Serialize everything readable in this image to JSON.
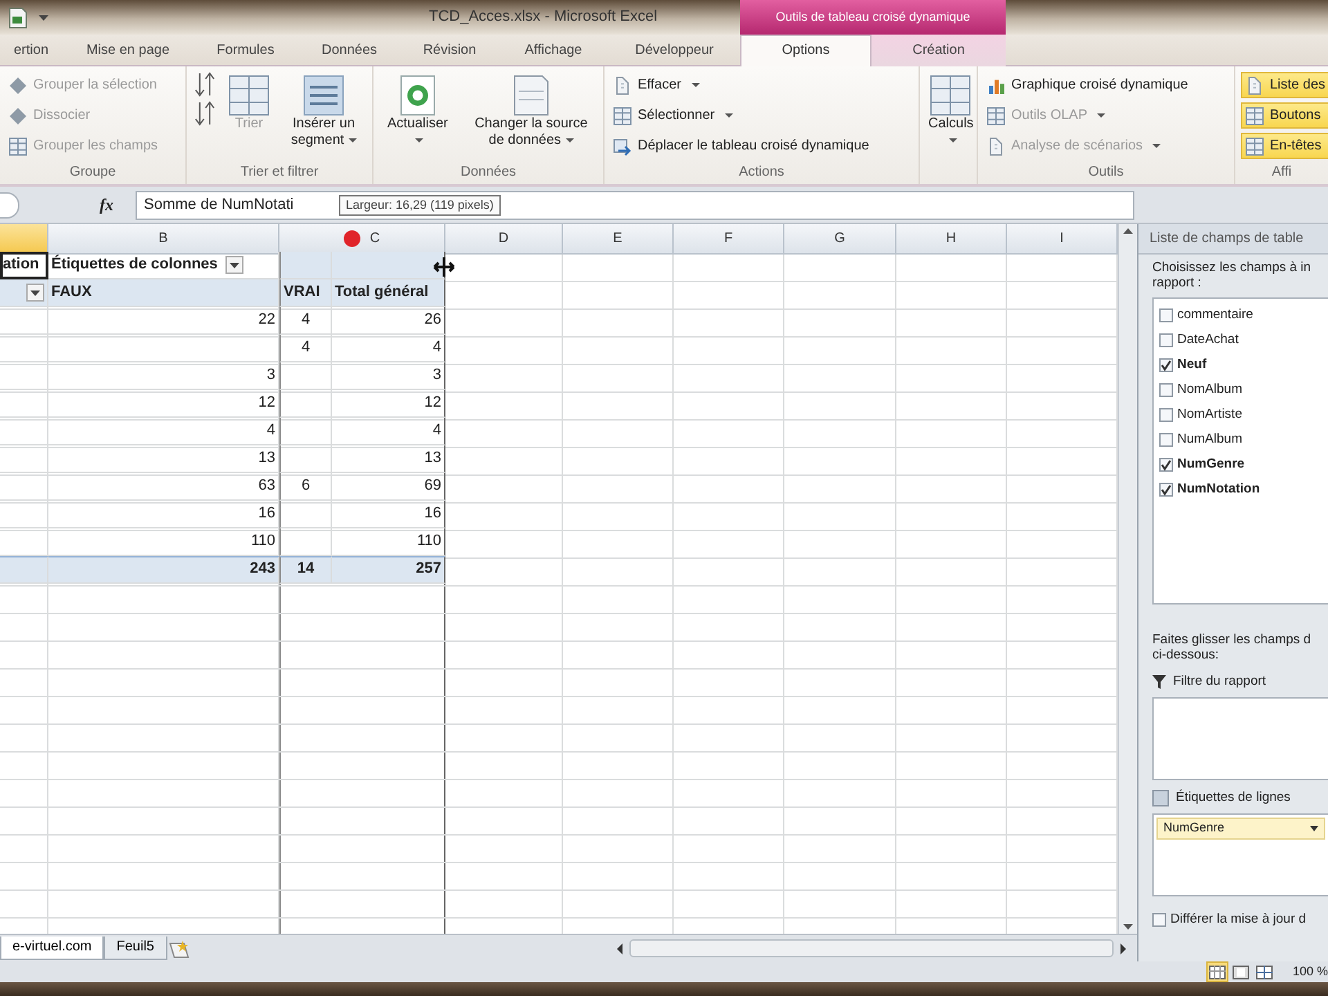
{
  "window": {
    "title": "TCD_Acces.xlsx - Microsoft Excel",
    "context_group": "Outils de tableau croisé dynamique"
  },
  "tabs": [
    {
      "label": "ertion",
      "selected": false,
      "context": false
    },
    {
      "label": "Mise en page",
      "selected": false,
      "context": false
    },
    {
      "label": "Formules",
      "selected": false,
      "context": false
    },
    {
      "label": "Données",
      "selected": false,
      "context": false
    },
    {
      "label": "Révision",
      "selected": false,
      "context": false
    },
    {
      "label": "Affichage",
      "selected": false,
      "context": false
    },
    {
      "label": "Développeur",
      "selected": false,
      "context": false
    },
    {
      "label": "Options",
      "selected": true,
      "context": true
    },
    {
      "label": "Création",
      "selected": false,
      "context": true
    }
  ],
  "ribbon_groups": [
    {
      "title": "Groupe",
      "columns": [
        [
          {
            "kind": "small",
            "label": "Grouper la sélection",
            "disabled": true,
            "dropdown": false
          },
          {
            "kind": "small",
            "label": "Dissocier",
            "disabled": true,
            "dropdown": false
          },
          {
            "kind": "small",
            "label": "Grouper les champs",
            "disabled": true,
            "dropdown": false
          }
        ]
      ]
    },
    {
      "title": "Trier et filtrer",
      "columns": [
        [
          {
            "kind": "icon",
            "disabled": false
          },
          {
            "kind": "icon",
            "disabled": false
          }
        ],
        [
          {
            "kind": "large",
            "label": "Trier",
            "disabled": true,
            "dropdown": false
          }
        ],
        [
          {
            "kind": "large",
            "label": "Insérer un segment",
            "disabled": false,
            "dropdown": true
          }
        ]
      ]
    },
    {
      "title": "Données",
      "columns": [
        [
          {
            "kind": "large",
            "label": "Actualiser",
            "disabled": false,
            "dropdown": true
          }
        ],
        [
          {
            "kind": "large",
            "label": "Changer la source de données",
            "disabled": false,
            "dropdown": true
          }
        ]
      ]
    },
    {
      "title": "Actions",
      "columns": [
        [
          {
            "kind": "small",
            "label": "Effacer",
            "disabled": false,
            "dropdown": true
          },
          {
            "kind": "small",
            "label": "Sélectionner",
            "disabled": false,
            "dropdown": true
          },
          {
            "kind": "small",
            "label": "Déplacer le tableau croisé dynamique",
            "disabled": false,
            "dropdown": false
          }
        ]
      ]
    },
    {
      "columns": [
        [
          {
            "kind": "large",
            "label": "Calculs",
            "disabled": false,
            "dropdown": true
          }
        ]
      ]
    },
    {
      "title": "Outils",
      "columns": [
        [
          {
            "kind": "small",
            "label": "Graphique croisé dynamique",
            "disabled": false,
            "dropdown": false
          },
          {
            "kind": "small",
            "label": "Outils OLAP",
            "disabled": true,
            "dropdown": true
          },
          {
            "kind": "small",
            "label": "Analyse de scénarios",
            "disabled": true,
            "dropdown": true
          }
        ]
      ]
    },
    {
      "title": "Affi",
      "columns": [
        [
          {
            "kind": "small",
            "label": "Liste des",
            "disabled": false,
            "on": true
          },
          {
            "kind": "small",
            "label": "Boutons",
            "disabled": false,
            "on": true
          },
          {
            "kind": "small",
            "label": "En-têtes",
            "disabled": false,
            "on": true
          }
        ]
      ]
    }
  ],
  "formula_bar": {
    "function_label": "fx",
    "content": "Somme de NumNotati",
    "tooltip": "Largeur: 16,29 (119 pixels)"
  },
  "column_headers": [
    {
      "selected": true
    },
    {
      "label": "B",
      "selected": false
    },
    {
      "label": "C",
      "selected": false
    },
    {
      "label": "D",
      "selected": false
    },
    {
      "label": "E",
      "selected": false
    },
    {
      "label": "F",
      "selected": false
    },
    {
      "label": "G",
      "selected": false
    },
    {
      "label": "H",
      "selected": false
    },
    {
      "label": "I",
      "selected": false
    }
  ],
  "rows": [
    {
      "kind": "column_labels",
      "cells": {
        "a": {
          "text": "ation",
          "selected": true
        },
        "b": {
          "text": "Étiquettes de colonnes",
          "dropdown": true,
          "selected": false
        }
      }
    },
    {
      "kind": "labels",
      "cells": {
        "a": {
          "dropdown": true,
          "selected": false
        },
        "b": {
          "text": "FAUX",
          "selected": false
        },
        "c": {
          "text": "VRAI",
          "selected": false
        },
        "d": {
          "text": "Total général",
          "selected": false
        }
      }
    },
    {
      "kind": "data",
      "cells": {
        "b": {
          "text": "22",
          "selected": false
        },
        "c": {
          "text": "4",
          "selected": false
        },
        "d": {
          "text": "26",
          "selected": false
        }
      }
    },
    {
      "kind": "data",
      "cells": {
        "c": {
          "text": "4",
          "selected": false
        },
        "d": {
          "text": "4",
          "selected": false
        }
      }
    },
    {
      "kind": "data",
      "cells": {
        "b": {
          "text": "3",
          "selected": false
        },
        "d": {
          "text": "3",
          "selected": false
        }
      }
    },
    {
      "kind": "data",
      "cells": {
        "b": {
          "text": "12",
          "selected": false
        },
        "d": {
          "text": "12",
          "selected": false
        }
      }
    },
    {
      "kind": "data",
      "cells": {
        "b": {
          "text": "4",
          "selected": false
        },
        "d": {
          "text": "4",
          "selected": false
        }
      }
    },
    {
      "kind": "data",
      "cells": {
        "b": {
          "text": "13",
          "selected": false
        },
        "d": {
          "text": "13",
          "selected": false
        }
      }
    },
    {
      "kind": "data",
      "cells": {
        "b": {
          "text": "63",
          "selected": false
        },
        "c": {
          "text": "6",
          "selected": false
        },
        "d": {
          "text": "69",
          "selected": false
        }
      }
    },
    {
      "kind": "data",
      "cells": {
        "b": {
          "text": "16",
          "selected": false
        },
        "d": {
          "text": "16",
          "selected": false
        }
      }
    },
    {
      "kind": "data",
      "cells": {
        "b": {
          "text": "110",
          "selected": false
        },
        "d": {
          "text": "110",
          "selected": false
        }
      }
    },
    {
      "kind": "total",
      "cells": {
        "b": {
          "text": "243",
          "selected": false
        },
        "c": {
          "text": "14",
          "selected": false
        },
        "d": {
          "text": "257",
          "selected": false
        }
      }
    }
  ],
  "sheet_tabs": [
    {
      "label": "e-virtuel.com",
      "selected": true
    },
    {
      "label": "Feuil5",
      "selected": false
    }
  ],
  "field_list": {
    "title": "Liste de champs de table",
    "instruction": "Choisissez les champs à in",
    "instruction_end": "rapport :",
    "fields": [
      {
        "label": "commentaire",
        "checked": false
      },
      {
        "label": "DateAchat",
        "checked": false
      },
      {
        "label": "Neuf",
        "checked": true
      },
      {
        "label": "NomAlbum",
        "checked": false
      },
      {
        "label": "NomArtiste",
        "checked": false
      },
      {
        "label": "NumAlbum",
        "checked": false
      },
      {
        "label": "NumGenre",
        "checked": true
      },
      {
        "label": "NumNotation",
        "checked": true
      }
    ],
    "drag_hint": "Faites glisser les champs d",
    "drag_hint_end": "ci-dessous:",
    "areas": [
      {
        "kind": "filter",
        "title": "Filtre du rapport"
      },
      {
        "kind": "rows",
        "title": "Étiquettes de lignes",
        "items": [
          {
            "label": "NumGenre"
          }
        ]
      }
    ],
    "defer": {
      "label": "Différer la mise à jour d",
      "checked": false
    }
  },
  "status_bar": {
    "views": [
      {
        "kind": "normal",
        "selected": true
      },
      {
        "kind": "page_layout",
        "selected": false
      },
      {
        "kind": "page_break",
        "selected": false
      }
    ],
    "zoom": "100 %"
  }
}
